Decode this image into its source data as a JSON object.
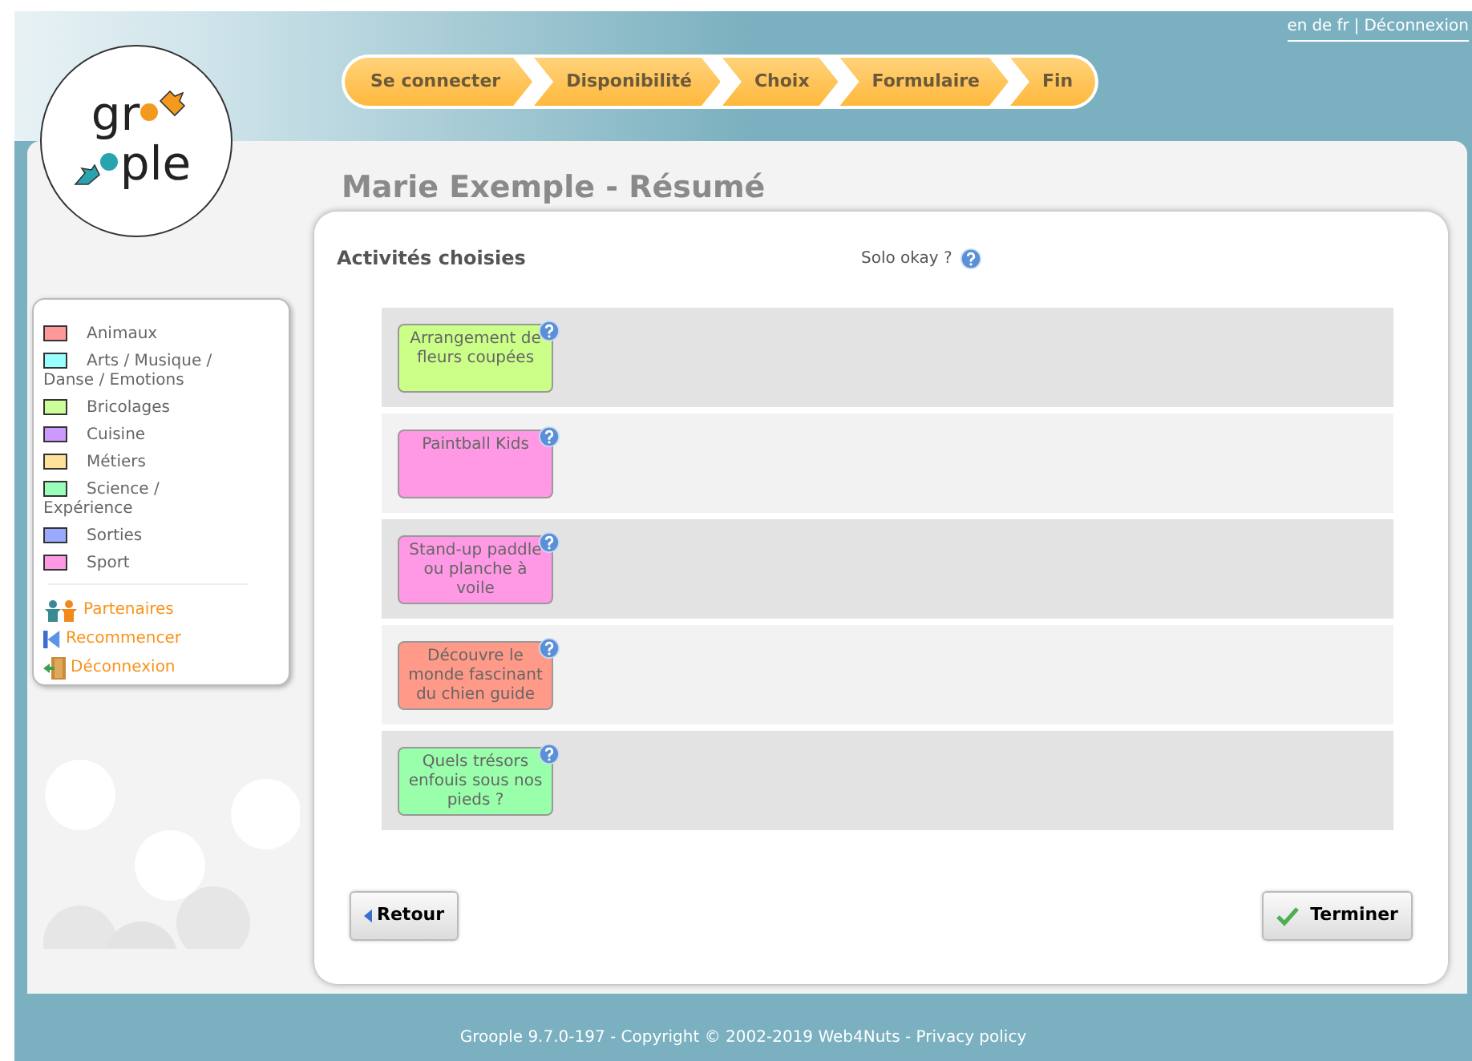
{
  "header_links": {
    "languages": [
      "en",
      "de",
      "fr"
    ],
    "separator": "|",
    "logout": "Déconnexion"
  },
  "logo": {
    "text_start": "gr",
    "text_end": "ple"
  },
  "steps": [
    "Se connecter",
    "Disponibilité",
    "Choix",
    "Formulaire",
    "Fin"
  ],
  "legend": [
    {
      "label": "Animaux",
      "color": "#ff9999"
    },
    {
      "label": "Arts / Musique / Danse / Emotions",
      "color": "#99ffff"
    },
    {
      "label": "Bricolages",
      "color": "#ccff99"
    },
    {
      "label": "Cuisine",
      "color": "#cc99ff"
    },
    {
      "label": "Métiers",
      "color": "#ffe199"
    },
    {
      "label": "Science / Expérience",
      "color": "#99ffbb"
    },
    {
      "label": "Sorties",
      "color": "#99aaff"
    },
    {
      "label": "Sport",
      "color": "#ff99e6"
    }
  ],
  "sidebar_links": [
    {
      "label": "Partenaires",
      "kind": "partners"
    },
    {
      "label": "Recommencer",
      "kind": "restart"
    },
    {
      "label": "Déconnexion",
      "kind": "logout"
    }
  ],
  "page_title": "Marie Exemple - Résumé",
  "section_title": "Activités choisies",
  "solo_label": "Solo okay ?",
  "activities": [
    {
      "title": "Arrangement de fleurs coupées",
      "color": "#ccff88"
    },
    {
      "title": "Paintball Kids",
      "color": "#ff99e6"
    },
    {
      "title": "Stand-up paddle ou planche à voile",
      "color": "#ff99e6"
    },
    {
      "title": "Découvre le monde fascinant du chien guide",
      "color": "#ff9988"
    },
    {
      "title": "Quels trésors enfouis sous nos pieds ?",
      "color": "#99ffaa"
    }
  ],
  "buttons": {
    "back": "Retour",
    "finish": "Terminer"
  },
  "footer": {
    "text": "Groople 9.7.0-197 - Copyright © 2002-2019 Web4Nuts - ",
    "link": "Privacy policy"
  }
}
